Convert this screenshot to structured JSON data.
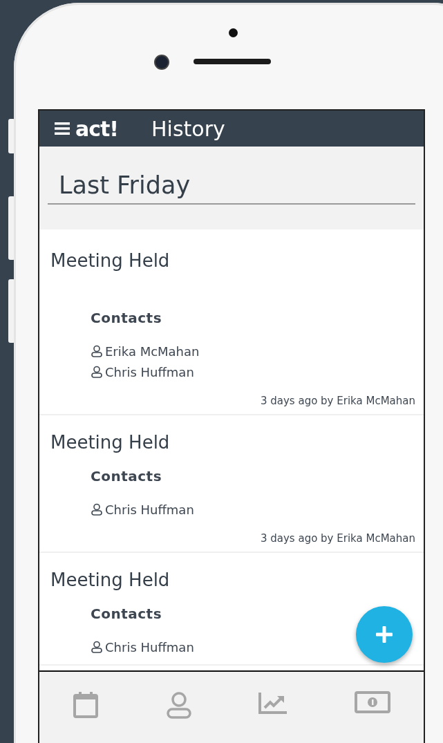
{
  "app_bar": {
    "logo": "act!",
    "title": "History"
  },
  "section": {
    "title": "Last Friday"
  },
  "entries": [
    {
      "title": "Meeting Held",
      "contacts_label": "Contacts",
      "contacts": [
        "Erika McMahan",
        "Chris Huffman"
      ],
      "footer": "3 days ago by Erika McMahan"
    },
    {
      "title": "Meeting Held",
      "contacts_label": "Contacts",
      "contacts": [
        "Chris Huffman"
      ],
      "footer": "3 days ago by Erika McMahan"
    },
    {
      "title": "Meeting Held",
      "contacts_label": "Contacts",
      "contacts": [
        "Chris Huffman"
      ]
    }
  ]
}
